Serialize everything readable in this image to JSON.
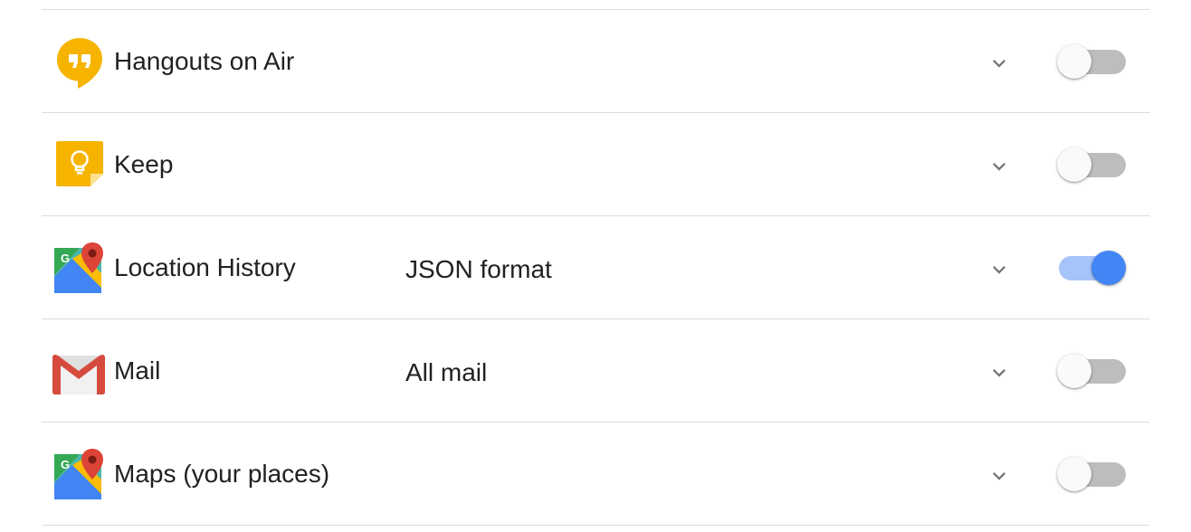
{
  "products": [
    {
      "name": "Hangouts on Air",
      "format": "",
      "icon": "hangouts-on-air-icon",
      "enabled": false
    },
    {
      "name": "Keep",
      "format": "",
      "icon": "keep-icon",
      "enabled": false
    },
    {
      "name": "Location History",
      "format": "JSON format",
      "icon": "google-maps-icon",
      "enabled": true
    },
    {
      "name": "Mail",
      "format": "All mail",
      "icon": "gmail-icon",
      "enabled": false
    },
    {
      "name": "Maps (your places)",
      "format": "",
      "icon": "google-maps-icon",
      "enabled": false
    }
  ],
  "colors": {
    "toggle_on_thumb": "#4285f4",
    "toggle_on_track": "#a6c3fa",
    "toggle_off_track": "#bdbdbd",
    "divider": "#dcdcdc"
  }
}
